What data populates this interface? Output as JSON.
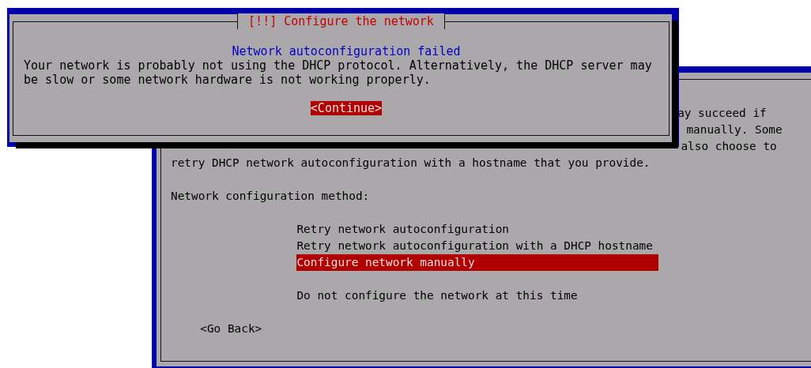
{
  "network_method_dialog": {
    "text_fragments": [
      "ay succeed if",
      "manually. Some",
      "also choose to"
    ],
    "text_line": "retry DHCP network autoconfiguration with a hostname that you provide.",
    "prompt": "Network configuration method:",
    "options": [
      {
        "label": "Retry network autoconfiguration",
        "selected": false
      },
      {
        "label": "Retry network autoconfiguration with a DHCP hostname",
        "selected": false
      },
      {
        "label": "Configure network manually",
        "selected": true
      },
      {
        "label": "Do not configure the network at this time",
        "selected": false
      }
    ],
    "back_button": "<Go Back>"
  },
  "alert_dialog": {
    "title": "[!!] Configure the network",
    "heading": "Network autoconfiguration failed",
    "message": "Your network is probably not using the DHCP protocol. Alternatively, the DHCP server may be slow or some network hardware is not working properly.",
    "button": "<Continue>"
  }
}
